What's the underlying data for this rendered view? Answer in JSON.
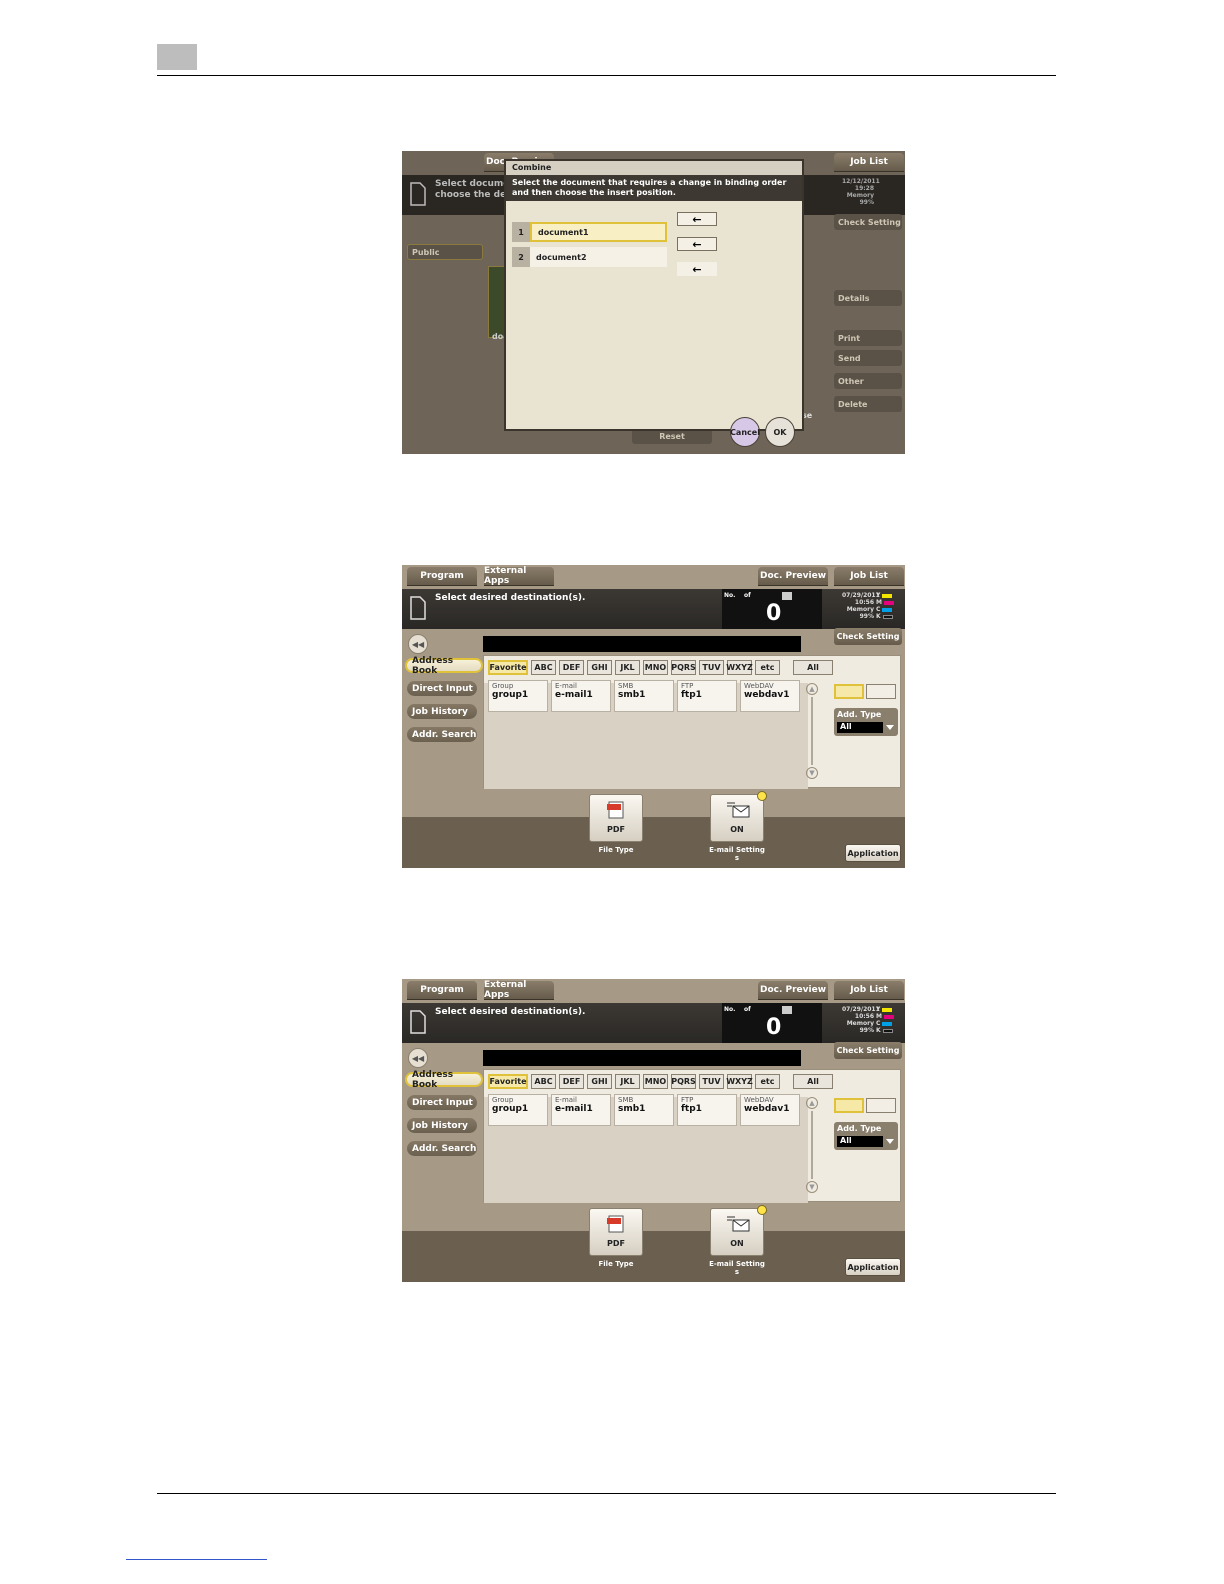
{
  "shot1": {
    "bg_labels": {
      "doc_preview": "Doc. Preview",
      "job_list": "Job List",
      "message": "Select document\nchoose the desire",
      "datetime": "12/12/2011\n19:28\nMemory\n99%",
      "check_setting": "Check Setting",
      "public": "Public",
      "doc_partial": "doc",
      "details": "Details",
      "print": "Print",
      "send": "Send",
      "other": "Other",
      "delete": "Delete",
      "reset": "Reset",
      "close_partial": "se"
    },
    "dialog": {
      "title": "Combine",
      "message": "Select the document that requires a change in binding order and  then choose the insert position.",
      "documents": [
        {
          "num": "1",
          "name": "document1"
        },
        {
          "num": "2",
          "name": "document2"
        }
      ],
      "arrow": "←",
      "cancel": "Cancel",
      "ok": "OK"
    }
  },
  "shot2": {
    "tabs_top": {
      "program": "Program",
      "external_apps": "External Apps",
      "doc_preview": "Doc. Preview",
      "job_list": "Job List"
    },
    "message": "Select desired destination(s).",
    "counter": {
      "no": "No.",
      "of": "of",
      "value": "0"
    },
    "status": "07/29/2011\n10:56\nMemory\n99%",
    "toner": [
      "Y",
      "M",
      "C",
      "K"
    ],
    "check_setting": "Check Setting",
    "side": [
      "Address Book",
      "Direct Input",
      "Job History",
      "Addr. Search"
    ],
    "index_tabs": [
      "Favorite",
      "ABC",
      "DEF",
      "GHI",
      "JKL",
      "MNO",
      "PQRS",
      "TUV",
      "WXYZ",
      "etc",
      "All"
    ],
    "destinations": [
      {
        "type": "Group",
        "name": "group1"
      },
      {
        "type": "E-mail",
        "name": "e-mail1"
      },
      {
        "type": "SMB",
        "name": "smb1"
      },
      {
        "type": "FTP",
        "name": "ftp1"
      },
      {
        "type": "WebDAV",
        "name": "webdav1"
      }
    ],
    "add_type": {
      "label": "Add. Type",
      "value": "All"
    },
    "file_type": {
      "value": "PDF",
      "label": "File Type"
    },
    "email": {
      "value": "ON",
      "label": "E-mail Setting\ns"
    },
    "application": "Application"
  },
  "shot3": {
    "tabs_top": {
      "program": "Program",
      "external_apps": "External Apps",
      "doc_preview": "Doc. Preview",
      "job_list": "Job List"
    },
    "message": "Select desired destination(s).",
    "counter": {
      "no": "No.",
      "of": "of",
      "value": "0"
    },
    "status": "07/29/2011\n10:56\nMemory\n99%",
    "toner": [
      "Y",
      "M",
      "C",
      "K"
    ],
    "check_setting": "Check Setting",
    "side": [
      "Address Book",
      "Direct Input",
      "Job History",
      "Addr. Search"
    ],
    "index_tabs": [
      "Favorite",
      "ABC",
      "DEF",
      "GHI",
      "JKL",
      "MNO",
      "PQRS",
      "TUV",
      "WXYZ",
      "etc",
      "All"
    ],
    "destinations": [
      {
        "type": "Group",
        "name": "group1"
      },
      {
        "type": "E-mail",
        "name": "e-mail1"
      },
      {
        "type": "SMB",
        "name": "smb1"
      },
      {
        "type": "FTP",
        "name": "ftp1"
      },
      {
        "type": "WebDAV",
        "name": "webdav1"
      }
    ],
    "add_type": {
      "label": "Add. Type",
      "value": "All"
    },
    "file_type": {
      "value": "PDF",
      "label": "File Type"
    },
    "email": {
      "value": "ON",
      "label": "E-mail Setting\ns"
    },
    "application": "Application"
  },
  "colors": {
    "accent": "#e0c23a",
    "panel": "#a69a86",
    "toner_y": "#f2e600",
    "toner_m": "#e6007e",
    "toner_c": "#00a0e9",
    "toner_k": "#111111"
  }
}
